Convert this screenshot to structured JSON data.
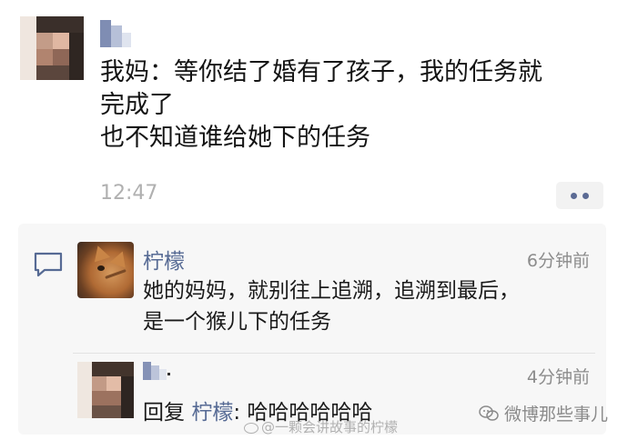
{
  "post": {
    "text_lines": [
      "我妈：等你结了婚有了孩子，我的任务就",
      "完成了",
      "也不知道谁给她下的任务"
    ],
    "time": "12:47"
  },
  "comments": [
    {
      "author": "柠檬",
      "time": "6分钟前",
      "text_lines": [
        "她的妈妈，就别往上追溯，追溯到最后，",
        "是一个猴儿下的任务"
      ]
    }
  ],
  "reply": {
    "time": "4分钟前",
    "prefix": "回复",
    "mention": "柠檬",
    "text": ": 哈哈哈哈哈哈"
  },
  "watermarks": {
    "weibo": "@一颗会讲故事的柠檬",
    "wechat": "微博那些事儿"
  },
  "colors": {
    "accent_link": "#566a94",
    "time_gray": "#b0b0b0",
    "panel_bg": "#f7f7f7"
  },
  "icons": {
    "comment": "comment-bubble-icon",
    "more": "more-dots-icon",
    "wechat": "wechat-logo-icon"
  }
}
